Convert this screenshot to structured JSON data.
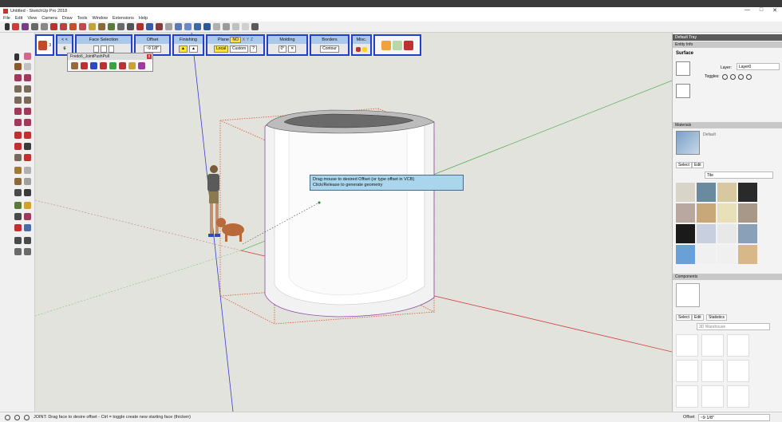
{
  "window": {
    "title": "Untitled - SketchUp Pro 2018",
    "controls": [
      "—",
      "□",
      "✕"
    ]
  },
  "menu": [
    "File",
    "Edit",
    "View",
    "Camera",
    "Draw",
    "Tools",
    "Window",
    "Extensions",
    "Help"
  ],
  "jpp_toolbar": {
    "counter": "3",
    "nav": "< < <",
    "face_selection": "Face Selection",
    "offset": "Offset",
    "offset_value": "~9 1/8\"",
    "finishing": "Finishing",
    "plane": "Plane",
    "plane_no": "NO",
    "plane_x": "X",
    "plane_y": "Y",
    "plane_z": "Z",
    "local": "Local",
    "custom": "Custom",
    "question": "?",
    "molding": "Molding",
    "molding_value": "0°",
    "borders": "Borders",
    "borders_value": "Contour",
    "misc": "Misc."
  },
  "palette": {
    "title": "Fredo6_JointPushPull",
    "close": "x"
  },
  "tooltip": {
    "line1": "Drag mouse to desired Offset (or type offset in VCB)",
    "line2": "Click/Release to generate geometry"
  },
  "status": {
    "message": "JOINT: Drag face to desire offset - Ctrl = toggle create new starting face (thicken)",
    "vcb_label": "Offset",
    "vcb_value": "~9 1/8\""
  },
  "tray": {
    "name": "Default Tray",
    "entity_info": "Entity Info",
    "entity_type": "Surface",
    "layer_label": "Layer:",
    "layer_value": "Layer0",
    "toggles_label": "Toggles:",
    "materials": "Materials",
    "material_name": "Default",
    "mat_select": "Select",
    "mat_edit": "Edit",
    "mat_category": "Tile",
    "components": "Components",
    "comp_select": "Select",
    "comp_edit": "Edit",
    "comp_statistics": "Statistics",
    "comp_search": "3D Warehouse"
  },
  "colors": {
    "accent": "#2340c8",
    "header": "#a9c8ea",
    "tooltip": "#a9d6ec",
    "viewport": "#e3e3de"
  }
}
